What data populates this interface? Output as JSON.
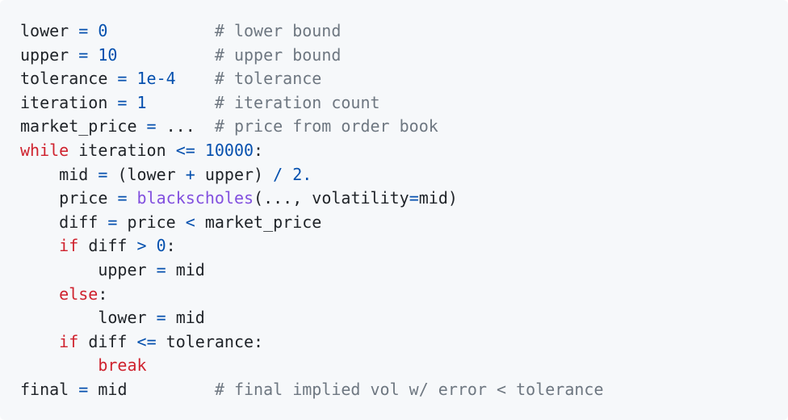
{
  "code_block": {
    "lines": [
      [
        {
          "t": "id",
          "v": "lower"
        },
        {
          "t": "ws",
          "v": " "
        },
        {
          "t": "op",
          "v": "="
        },
        {
          "t": "ws",
          "v": " "
        },
        {
          "t": "num",
          "v": "0"
        },
        {
          "t": "ws",
          "v": "           "
        },
        {
          "t": "cm",
          "v": "# lower bound"
        }
      ],
      [
        {
          "t": "id",
          "v": "upper"
        },
        {
          "t": "ws",
          "v": " "
        },
        {
          "t": "op",
          "v": "="
        },
        {
          "t": "ws",
          "v": " "
        },
        {
          "t": "num",
          "v": "10"
        },
        {
          "t": "ws",
          "v": "          "
        },
        {
          "t": "cm",
          "v": "# upper bound"
        }
      ],
      [
        {
          "t": "id",
          "v": "tolerance"
        },
        {
          "t": "ws",
          "v": " "
        },
        {
          "t": "op",
          "v": "="
        },
        {
          "t": "ws",
          "v": " "
        },
        {
          "t": "num",
          "v": "1e-4"
        },
        {
          "t": "ws",
          "v": "    "
        },
        {
          "t": "cm",
          "v": "# tolerance"
        }
      ],
      [
        {
          "t": "id",
          "v": "iteration"
        },
        {
          "t": "ws",
          "v": " "
        },
        {
          "t": "op",
          "v": "="
        },
        {
          "t": "ws",
          "v": " "
        },
        {
          "t": "num",
          "v": "1"
        },
        {
          "t": "ws",
          "v": "       "
        },
        {
          "t": "cm",
          "v": "# iteration count"
        }
      ],
      [
        {
          "t": "id",
          "v": "market_price"
        },
        {
          "t": "ws",
          "v": " "
        },
        {
          "t": "op",
          "v": "="
        },
        {
          "t": "ws",
          "v": " "
        },
        {
          "t": "id",
          "v": "..."
        },
        {
          "t": "ws",
          "v": "  "
        },
        {
          "t": "cm",
          "v": "# price from order book"
        }
      ],
      [
        {
          "t": "kw",
          "v": "while"
        },
        {
          "t": "ws",
          "v": " "
        },
        {
          "t": "id",
          "v": "iteration"
        },
        {
          "t": "ws",
          "v": " "
        },
        {
          "t": "op",
          "v": "<="
        },
        {
          "t": "ws",
          "v": " "
        },
        {
          "t": "num",
          "v": "10000"
        },
        {
          "t": "id",
          "v": ":"
        }
      ],
      [
        {
          "t": "ws",
          "v": "    "
        },
        {
          "t": "id",
          "v": "mid"
        },
        {
          "t": "ws",
          "v": " "
        },
        {
          "t": "op",
          "v": "="
        },
        {
          "t": "ws",
          "v": " "
        },
        {
          "t": "id",
          "v": "(lower"
        },
        {
          "t": "ws",
          "v": " "
        },
        {
          "t": "op",
          "v": "+"
        },
        {
          "t": "ws",
          "v": " "
        },
        {
          "t": "id",
          "v": "upper)"
        },
        {
          "t": "ws",
          "v": " "
        },
        {
          "t": "op",
          "v": "/"
        },
        {
          "t": "ws",
          "v": " "
        },
        {
          "t": "num",
          "v": "2."
        }
      ],
      [
        {
          "t": "ws",
          "v": "    "
        },
        {
          "t": "id",
          "v": "price"
        },
        {
          "t": "ws",
          "v": " "
        },
        {
          "t": "op",
          "v": "="
        },
        {
          "t": "ws",
          "v": " "
        },
        {
          "t": "fn",
          "v": "blackscholes"
        },
        {
          "t": "id",
          "v": "(..., volatility"
        },
        {
          "t": "op",
          "v": "="
        },
        {
          "t": "id",
          "v": "mid)"
        }
      ],
      [
        {
          "t": "ws",
          "v": "    "
        },
        {
          "t": "id",
          "v": "diff"
        },
        {
          "t": "ws",
          "v": " "
        },
        {
          "t": "op",
          "v": "="
        },
        {
          "t": "ws",
          "v": " "
        },
        {
          "t": "id",
          "v": "price"
        },
        {
          "t": "ws",
          "v": " "
        },
        {
          "t": "op",
          "v": "<"
        },
        {
          "t": "ws",
          "v": " "
        },
        {
          "t": "id",
          "v": "market_price"
        }
      ],
      [
        {
          "t": "ws",
          "v": "    "
        },
        {
          "t": "kw",
          "v": "if"
        },
        {
          "t": "ws",
          "v": " "
        },
        {
          "t": "id",
          "v": "diff"
        },
        {
          "t": "ws",
          "v": " "
        },
        {
          "t": "op",
          "v": ">"
        },
        {
          "t": "ws",
          "v": " "
        },
        {
          "t": "num",
          "v": "0"
        },
        {
          "t": "id",
          "v": ":"
        }
      ],
      [
        {
          "t": "ws",
          "v": "        "
        },
        {
          "t": "id",
          "v": "upper"
        },
        {
          "t": "ws",
          "v": " "
        },
        {
          "t": "op",
          "v": "="
        },
        {
          "t": "ws",
          "v": " "
        },
        {
          "t": "id",
          "v": "mid"
        }
      ],
      [
        {
          "t": "ws",
          "v": "    "
        },
        {
          "t": "kw",
          "v": "else"
        },
        {
          "t": "id",
          "v": ":"
        }
      ],
      [
        {
          "t": "ws",
          "v": "        "
        },
        {
          "t": "id",
          "v": "lower"
        },
        {
          "t": "ws",
          "v": " "
        },
        {
          "t": "op",
          "v": "="
        },
        {
          "t": "ws",
          "v": " "
        },
        {
          "t": "id",
          "v": "mid"
        }
      ],
      [
        {
          "t": "ws",
          "v": "    "
        },
        {
          "t": "kw",
          "v": "if"
        },
        {
          "t": "ws",
          "v": " "
        },
        {
          "t": "id",
          "v": "diff"
        },
        {
          "t": "ws",
          "v": " "
        },
        {
          "t": "op",
          "v": "<="
        },
        {
          "t": "ws",
          "v": " "
        },
        {
          "t": "id",
          "v": "tolerance:"
        }
      ],
      [
        {
          "t": "ws",
          "v": "        "
        },
        {
          "t": "kw",
          "v": "break"
        }
      ],
      [
        {
          "t": "id",
          "v": "final"
        },
        {
          "t": "ws",
          "v": " "
        },
        {
          "t": "op",
          "v": "="
        },
        {
          "t": "ws",
          "v": " "
        },
        {
          "t": "id",
          "v": "mid"
        },
        {
          "t": "ws",
          "v": "         "
        },
        {
          "t": "cm",
          "v": "# final implied vol w/ error < tolerance"
        }
      ]
    ]
  }
}
